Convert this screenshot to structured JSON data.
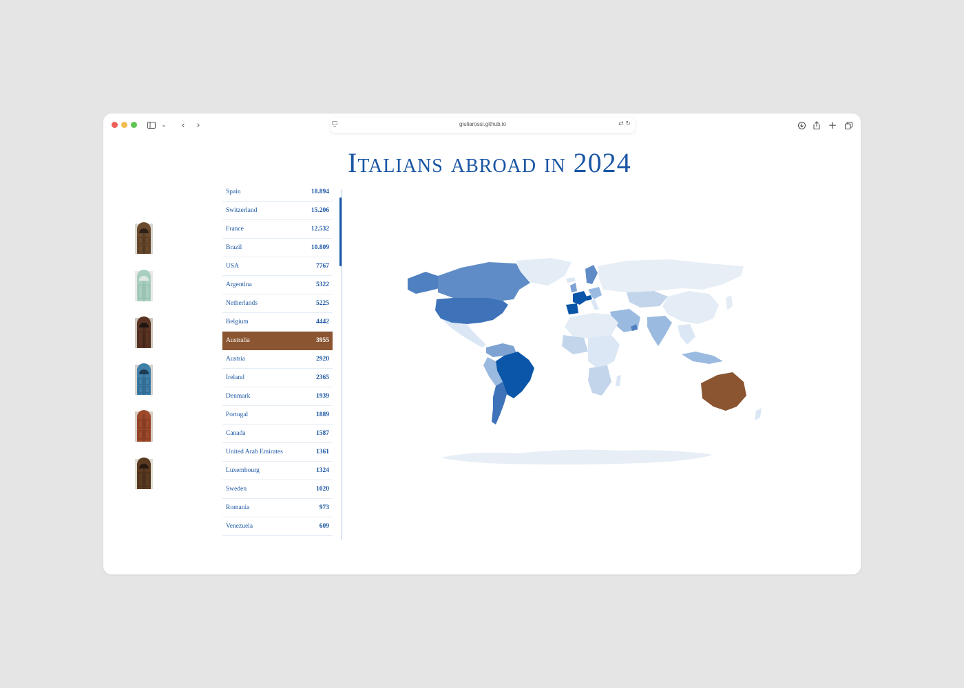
{
  "browser": {
    "url": "giuliarossi.github.io",
    "traffic_lights": [
      "#ed5f57",
      "#f4bd4f",
      "#5fc454"
    ]
  },
  "page": {
    "title": "Italians abroad in 2024"
  },
  "colors": {
    "accent": "#1a56a4",
    "highlight": "#8a5530",
    "map_dark": "#0b56a8",
    "map_mid": "#4f81c0",
    "map_light": "#9bbae0",
    "map_pale": "#dbe7f4"
  },
  "doors": [
    {
      "name": "door-wooden-arch",
      "color": "#6b4a2d"
    },
    {
      "name": "door-mint",
      "color": "#a9cfc0"
    },
    {
      "name": "door-dark-wood",
      "color": "#5a3323"
    },
    {
      "name": "door-blue",
      "color": "#3f7fa8"
    },
    {
      "name": "door-red-wood",
      "color": "#9d4a2c"
    },
    {
      "name": "door-brown-arch",
      "color": "#5b3a22"
    }
  ],
  "countries": [
    {
      "name": "Spain",
      "value": "18.894"
    },
    {
      "name": "Switzerland",
      "value": "15.206"
    },
    {
      "name": "France",
      "value": "12.532"
    },
    {
      "name": "Brazil",
      "value": "10.809"
    },
    {
      "name": "USA",
      "value": "7767"
    },
    {
      "name": "Argentina",
      "value": "5322"
    },
    {
      "name": "Netherlands",
      "value": "5225"
    },
    {
      "name": "Belgium",
      "value": "4442"
    },
    {
      "name": "Australia",
      "value": "3955"
    },
    {
      "name": "Austria",
      "value": "2920"
    },
    {
      "name": "Ireland",
      "value": "2365"
    },
    {
      "name": "Denmark",
      "value": "1939"
    },
    {
      "name": "Portugal",
      "value": "1889"
    },
    {
      "name": "Canada",
      "value": "1587"
    },
    {
      "name": "United Arab Emirates",
      "value": "1361"
    },
    {
      "name": "Luxembourg",
      "value": "1324"
    },
    {
      "name": "Sweden",
      "value": "1020"
    },
    {
      "name": "Romania",
      "value": "973"
    },
    {
      "name": "Venezuela",
      "value": "609"
    }
  ],
  "selected_country": "Australia"
}
